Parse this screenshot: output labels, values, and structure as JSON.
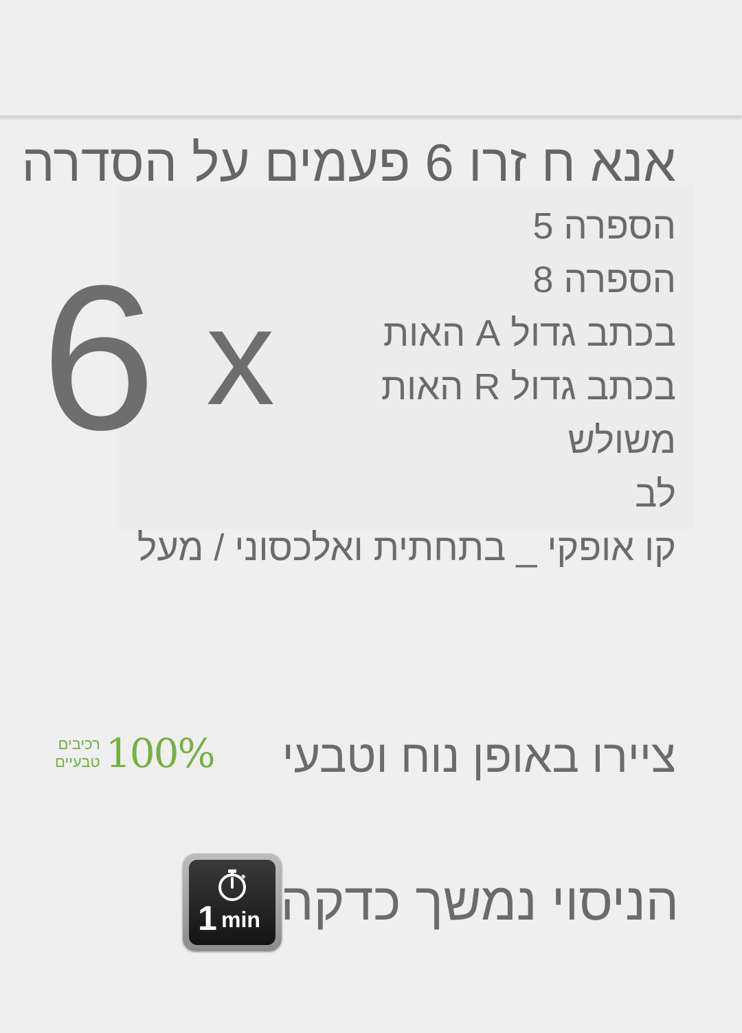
{
  "title": "אנא ח זרו 6 פעמים על הסדרה",
  "items": [
    "הספרה 5",
    "הספרה 8",
    "בכתב גדול A האות",
    "בכתב גדול R האות",
    "משולש",
    "לב",
    "קו אופקי _ בתחתית ואלכסוני / מעל"
  ],
  "repeat": {
    "count": "6",
    "times_symbol": "x"
  },
  "natural": {
    "text": "ציירו באופן נוח וטבעי",
    "badge_percent": "100%",
    "badge_line1": "רכיבים",
    "badge_line2": "טבעיים",
    "badge_color": "#76b043",
    "badge_icon": "leaf-icon"
  },
  "timer": {
    "text": "הניסוי נמשך כדקה",
    "icon": "stopwatch-icon",
    "number": "1",
    "unit": "min"
  },
  "colors": {
    "text": "#6b6b6b",
    "background": "#efefef"
  }
}
